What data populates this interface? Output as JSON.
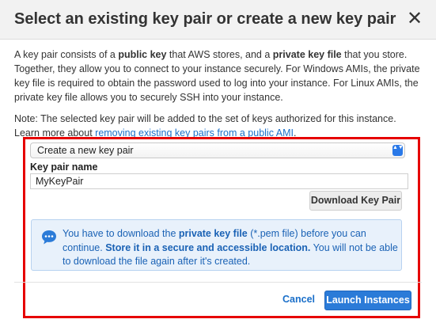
{
  "dialog": {
    "title": "Select an existing key pair or create a new key pair",
    "close_glyph": "✕"
  },
  "intro": {
    "t1": "A key pair consists of a ",
    "b1": "public key",
    "t2": " that AWS stores, and a ",
    "b2": "private key file",
    "t3": " that you store. Together, they allow you to connect to your instance securely. For Windows AMIs, the private key file is required to obtain the password used to log into your instance. For Linux AMIs, the private key file allows you to securely SSH into your instance."
  },
  "note": {
    "text": "Note: The selected key pair will be added to the set of keys authorized for this instance. Learn more about ",
    "link": "removing existing key pairs from a public AMI",
    "end": "."
  },
  "keypair_select": {
    "selected": "Create a new key pair",
    "arrows": "▲▼"
  },
  "key_pair_name": {
    "label": "Key pair name",
    "value": "MyKeyPair"
  },
  "download_button": "Download Key Pair",
  "alert": {
    "icon": "speech-bubble-icon",
    "t1": "You have to download the ",
    "b1": "private key file",
    "t2": " (*.pem file) before you can continue. ",
    "b2": "Store it in a secure and accessible location.",
    "t3": " You will not be able to download the file again after it's created."
  },
  "footer": {
    "cancel": "Cancel",
    "launch": "Launch Instances"
  },
  "colors": {
    "highlight_frame": "#e60000",
    "primary": "#2b7bd8",
    "link": "#1a6fc9",
    "alert_bg": "#e8f1fb"
  }
}
